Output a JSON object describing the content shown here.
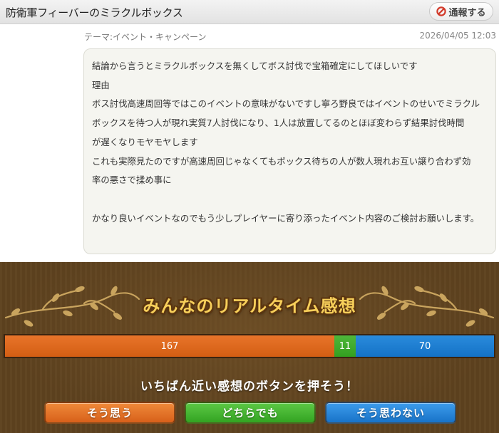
{
  "header": {
    "title": "防衛軍フィーバーのミラクルボックス",
    "report_label": "通報する"
  },
  "post": {
    "theme": "テーマ:イベント・キャンペーン",
    "date": "2026/04/05 12:03",
    "lines": [
      "結論から言うとミラクルボックスを無くしてボス討伐で宝箱確定にしてほしいです",
      "理由",
      "ボス討伐高速周回等ではこのイベントの意味がないですし寧ろ野良ではイベントのせいでミラクル",
      "ボックスを待つ人が現れ実質7人討伐になり、1人は放置してるのとほぼ変わらず結果討伐時間",
      "が遅くなりモヤモヤします",
      "これも実際見たのですが高速周回じゃなくてもボックス待ちの人が数人現れお互い譲り合わず効",
      "率の悪さで揉め事に",
      "",
      "かなり良いイベントなのでもう少しプレイヤーに寄り添ったイベント内容のご検討お願いします。"
    ]
  },
  "realtime": {
    "title": "みんなのリアルタイム感想",
    "counts": {
      "agree": 167,
      "either": 11,
      "disagree": 70
    },
    "prompt": "いちばん近い感想のボタンを押そう！",
    "buttons": {
      "agree": "そう思う",
      "either": "どちらでも",
      "disagree": "そう思わない"
    },
    "colors": {
      "agree": "#d9661b",
      "either": "#3aa527",
      "disagree": "#1a7ad0",
      "panel": "#5e421f",
      "title": "#f7cf5a"
    }
  }
}
